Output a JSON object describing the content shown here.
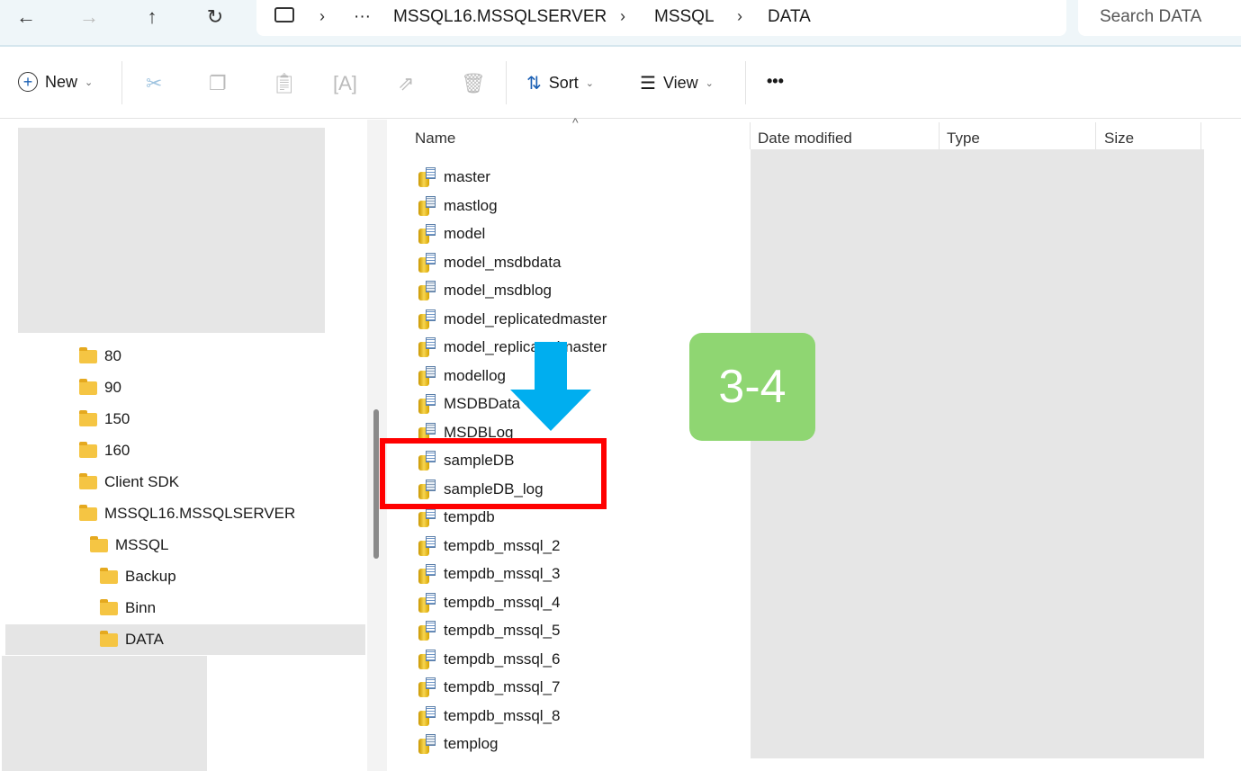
{
  "nav_buttons": {
    "back": "←",
    "forward": "→",
    "up": "↑",
    "refresh": "↻"
  },
  "breadcrumb": {
    "overflow": "···",
    "items": [
      "MSSQL16.MSSQLSERVER",
      "MSSQL",
      "DATA"
    ]
  },
  "search": {
    "placeholder": "Search DATA"
  },
  "toolbar": {
    "new_label": "New",
    "sort_label": "Sort",
    "view_label": "View",
    "more": "•••"
  },
  "sidebar": {
    "items": [
      {
        "label": "80",
        "indent": 0
      },
      {
        "label": "90",
        "indent": 0
      },
      {
        "label": "150",
        "indent": 0
      },
      {
        "label": "160",
        "indent": 0
      },
      {
        "label": "Client SDK",
        "indent": 0
      },
      {
        "label": "MSSQL16.MSSQLSERVER",
        "indent": 0
      },
      {
        "label": "MSSQL",
        "indent": 1
      },
      {
        "label": "Backup",
        "indent": 2
      },
      {
        "label": "Binn",
        "indent": 2
      },
      {
        "label": "DATA",
        "indent": 2,
        "selected": true
      }
    ]
  },
  "columns": [
    "Name",
    "Date modified",
    "Type",
    "Size"
  ],
  "files": [
    {
      "name": "master",
      "kind": "data"
    },
    {
      "name": "mastlog",
      "kind": "log"
    },
    {
      "name": "model",
      "kind": "data"
    },
    {
      "name": "model_msdbdata",
      "kind": "data"
    },
    {
      "name": "model_msdblog",
      "kind": "log"
    },
    {
      "name": "model_replicatedmaster",
      "kind": "data"
    },
    {
      "name": "model_replicatedmaster",
      "kind": "data"
    },
    {
      "name": "modellog",
      "kind": "log"
    },
    {
      "name": "MSDBData",
      "kind": "data"
    },
    {
      "name": "MSDBLog",
      "kind": "log"
    },
    {
      "name": "sampleDB",
      "kind": "data"
    },
    {
      "name": "sampleDB_log",
      "kind": "log"
    },
    {
      "name": "tempdb",
      "kind": "data"
    },
    {
      "name": "tempdb_mssql_2",
      "kind": "data"
    },
    {
      "name": "tempdb_mssql_3",
      "kind": "data"
    },
    {
      "name": "tempdb_mssql_4",
      "kind": "data"
    },
    {
      "name": "tempdb_mssql_5",
      "kind": "data"
    },
    {
      "name": "tempdb_mssql_6",
      "kind": "data"
    },
    {
      "name": "tempdb_mssql_7",
      "kind": "data"
    },
    {
      "name": "tempdb_mssql_8",
      "kind": "data"
    },
    {
      "name": "templog",
      "kind": "log"
    }
  ],
  "annotation": {
    "step_label": "3-4",
    "badge_color": "#8fd672",
    "arrow_color": "#00aeef",
    "highlight_color": "#ff0000"
  }
}
